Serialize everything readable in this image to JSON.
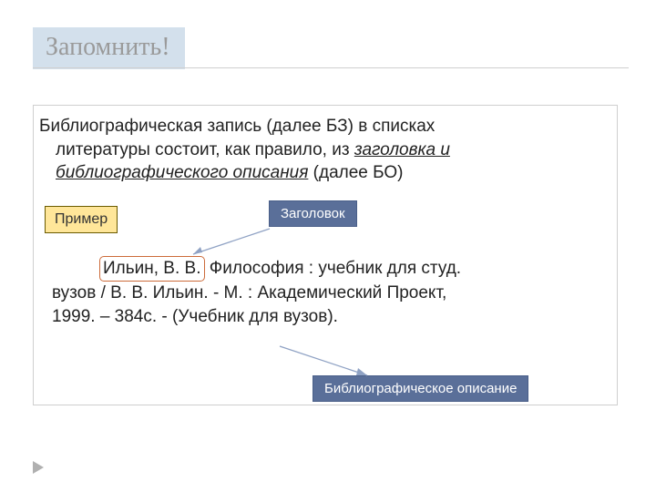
{
  "title": "Запомнить!",
  "intro": {
    "line1": "Библиографическая запись (далее БЗ) в списках",
    "line2a": "литературы состоит, как правило, из ",
    "line2b": "заголовка и",
    "line3a": "библиографического описания",
    "line3b": " (далее БО)"
  },
  "labels": {
    "example": "Пример",
    "heading": "Заголовок",
    "description": "Библиографическое описание"
  },
  "entry": {
    "author": "Ильин, В. В.",
    "rest_line1": " Философия : учебник для студ.",
    "line2": "вузов / В. В. Ильин. - М. : Академический Проект,",
    "line3": "1999. – 384с. -  (Учебник для вузов)."
  }
}
